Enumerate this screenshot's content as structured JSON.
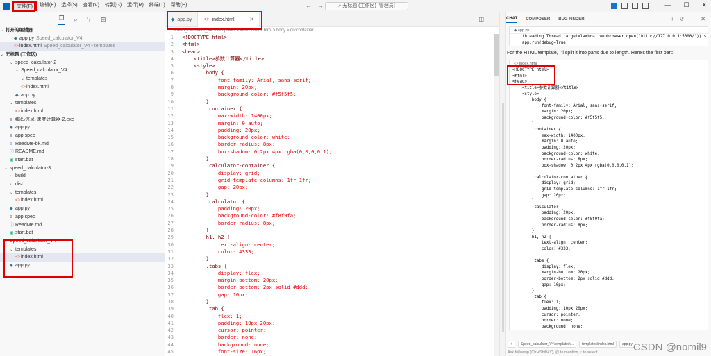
{
  "menu": [
    "文件(F)",
    "编辑(E)",
    "选择(S)",
    "查看(V)",
    "转到(G)",
    "运行(R)",
    "终端(T)",
    "帮助(H)"
  ],
  "search": {
    "text": "无标题 (工作区) [管理员]"
  },
  "sidebar": {
    "open_editors_title": "打开的编辑器",
    "open_editors": [
      {
        "name": "app.py",
        "path": "Speed_calculator_V4",
        "icon": "py"
      },
      {
        "name": "index.html",
        "path": "Speed_calculator_V4 • templates",
        "icon": "html"
      }
    ],
    "workspace_title": "无标题 (工作区)",
    "tree": [
      {
        "label": "speed_calculator-2",
        "indent": 1,
        "type": "folder"
      },
      {
        "label": "Speed_calculator_V4",
        "indent": 2,
        "type": "folder"
      },
      {
        "label": "templates",
        "indent": 3,
        "type": "folder"
      },
      {
        "label": "index.html",
        "indent": 3,
        "type": "html"
      },
      {
        "label": "app.py",
        "indent": 2,
        "type": "py"
      },
      {
        "label": "templates",
        "indent": 1,
        "type": "folder"
      },
      {
        "label": "index.html",
        "indent": 2,
        "type": "html"
      },
      {
        "label": "编码信息-速度计算器-2.exe",
        "indent": 1,
        "type": "exe"
      },
      {
        "label": "app.py",
        "indent": 1,
        "type": "py"
      },
      {
        "label": "app.spec",
        "indent": 1,
        "type": "spec"
      },
      {
        "label": "ReadMe-bk.md",
        "indent": 1,
        "type": "md"
      },
      {
        "label": "README.md",
        "indent": 1,
        "type": "info"
      },
      {
        "label": "start.bat",
        "indent": 1,
        "type": "bat"
      },
      {
        "label": "speed_calculator-3",
        "indent": 0,
        "type": "folder"
      },
      {
        "label": "build",
        "indent": 1,
        "type": "folder"
      },
      {
        "label": "dist",
        "indent": 1,
        "type": "folder"
      },
      {
        "label": "templates",
        "indent": 1,
        "type": "folder"
      },
      {
        "label": "index.html",
        "indent": 2,
        "type": "html"
      },
      {
        "label": "app.py",
        "indent": 1,
        "type": "py"
      },
      {
        "label": "app.spec",
        "indent": 1,
        "type": "spec"
      },
      {
        "label": "ReadMe.md",
        "indent": 1,
        "type": "info"
      },
      {
        "label": "start.bat",
        "indent": 1,
        "type": "bat"
      },
      {
        "label": "Speed_calculator_V4",
        "indent": 0,
        "type": "folder"
      },
      {
        "label": "templates",
        "indent": 1,
        "type": "folder"
      },
      {
        "label": "index.html",
        "indent": 2,
        "type": "html",
        "selected": true
      },
      {
        "label": "app.py",
        "indent": 1,
        "type": "py"
      }
    ]
  },
  "editor": {
    "tabs": [
      {
        "label": "app.py",
        "icon": "py",
        "active": false
      },
      {
        "label": "index.html",
        "icon": "html",
        "active": true
      }
    ],
    "breadcrumb": "speed_calculator_V4 > templates > index.html > html > body > div.container",
    "lines": [
      "<!DOCTYPE html>",
      "<html>",
      "<head>",
      "    <title>参数计算器</title>",
      "    <style>",
      "        body {",
      "            font-family: Arial, sans-serif;",
      "            margin: 20px;",
      "            background-color: #f5f5f5;",
      "        }",
      "        .container {",
      "            max-width: 1400px;",
      "            margin: 0 auto;",
      "            padding: 20px;",
      "            background-color: white;",
      "            border-radius: 8px;",
      "            box-shadow: 0 2px 4px rgba(0,0,0,0.1);",
      "        }",
      "        .calculator-container {",
      "            display: grid;",
      "            grid-template-columns: 1fr 1fr;",
      "            gap: 20px;",
      "        }",
      "        .calculator {",
      "            padding: 20px;",
      "            background-color: #f8f9fa;",
      "            border-radius: 8px;",
      "        }",
      "        h1, h2 {",
      "            text-align: center;",
      "            color: #333;",
      "        }",
      "        .tabs {",
      "            display: flex;",
      "            margin-bottom: 20px;",
      "            border-bottom: 2px solid #ddd;",
      "            gap: 10px;",
      "        }",
      "        .tab {",
      "            flex: 1;",
      "            padding: 10px 20px;",
      "            cursor: pointer;",
      "            border: none;",
      "            background: none;",
      "            font-size: 16px;"
    ]
  },
  "chat": {
    "tabs": [
      "CHAT",
      "COMPOSER",
      "BUG FINDER"
    ],
    "top_block": {
      "header": "app.py",
      "lines": [
        "    threading.Thread(target=lambda: webbrowser.open('http://127.0.0.1:5000/')).s",
        "    app.run(debug=True)"
      ]
    },
    "message": "For the HTML template, I'll split it into parts due to length. Here's the first part:",
    "code_block": {
      "header": "index.html",
      "lines": [
        "<!DOCTYPE html>",
        "<html>",
        "<head>",
        "    <title>参数计算器</title>",
        "    <style>",
        "        body {",
        "            font-family: Arial, sans-serif;",
        "            margin: 20px;",
        "            background-color: #f5f5f5;",
        "        }",
        "        .container {",
        "            max-width: 1400px;",
        "            margin: 0 auto;",
        "            padding: 20px;",
        "            background-color: white;",
        "            border-radius: 8px;",
        "            box-shadow: 0 2px 4px rgba(0,0,0,0.1);",
        "        }",
        "        .calculator-container {",
        "            display: grid;",
        "            grid-template-columns: 1fr 1fr;",
        "            gap: 20px;",
        "        }",
        "        .calculator {",
        "            padding: 20px;",
        "            background-color: #f8f9fa;",
        "            border-radius: 8px;",
        "        }",
        "        h1, h2 {",
        "            text-align: center;",
        "            color: #333;",
        "        }",
        "        .tabs {",
        "            display: flex;",
        "            margin-bottom: 20px;",
        "            border-bottom: 2px solid #ddd;",
        "            gap: 10px;",
        "        }",
        "        .tab {",
        "            flex: 1;",
        "            padding: 10px 20px;",
        "            cursor: pointer;",
        "            border: none;",
        "            background: none;"
      ]
    },
    "context_chips": [
      "Speed_calculator_V4\\templates\\...",
      "templates\\index.html",
      "app.py"
    ],
    "input_placeholder": "Ask followup (Ctrl+Shift+Y), @ to mention, ↑ to select"
  },
  "watermark": "CSDN @nomil9",
  "colors": {
    "accent": "#0066b8",
    "highlight_box": "#dd0000"
  }
}
